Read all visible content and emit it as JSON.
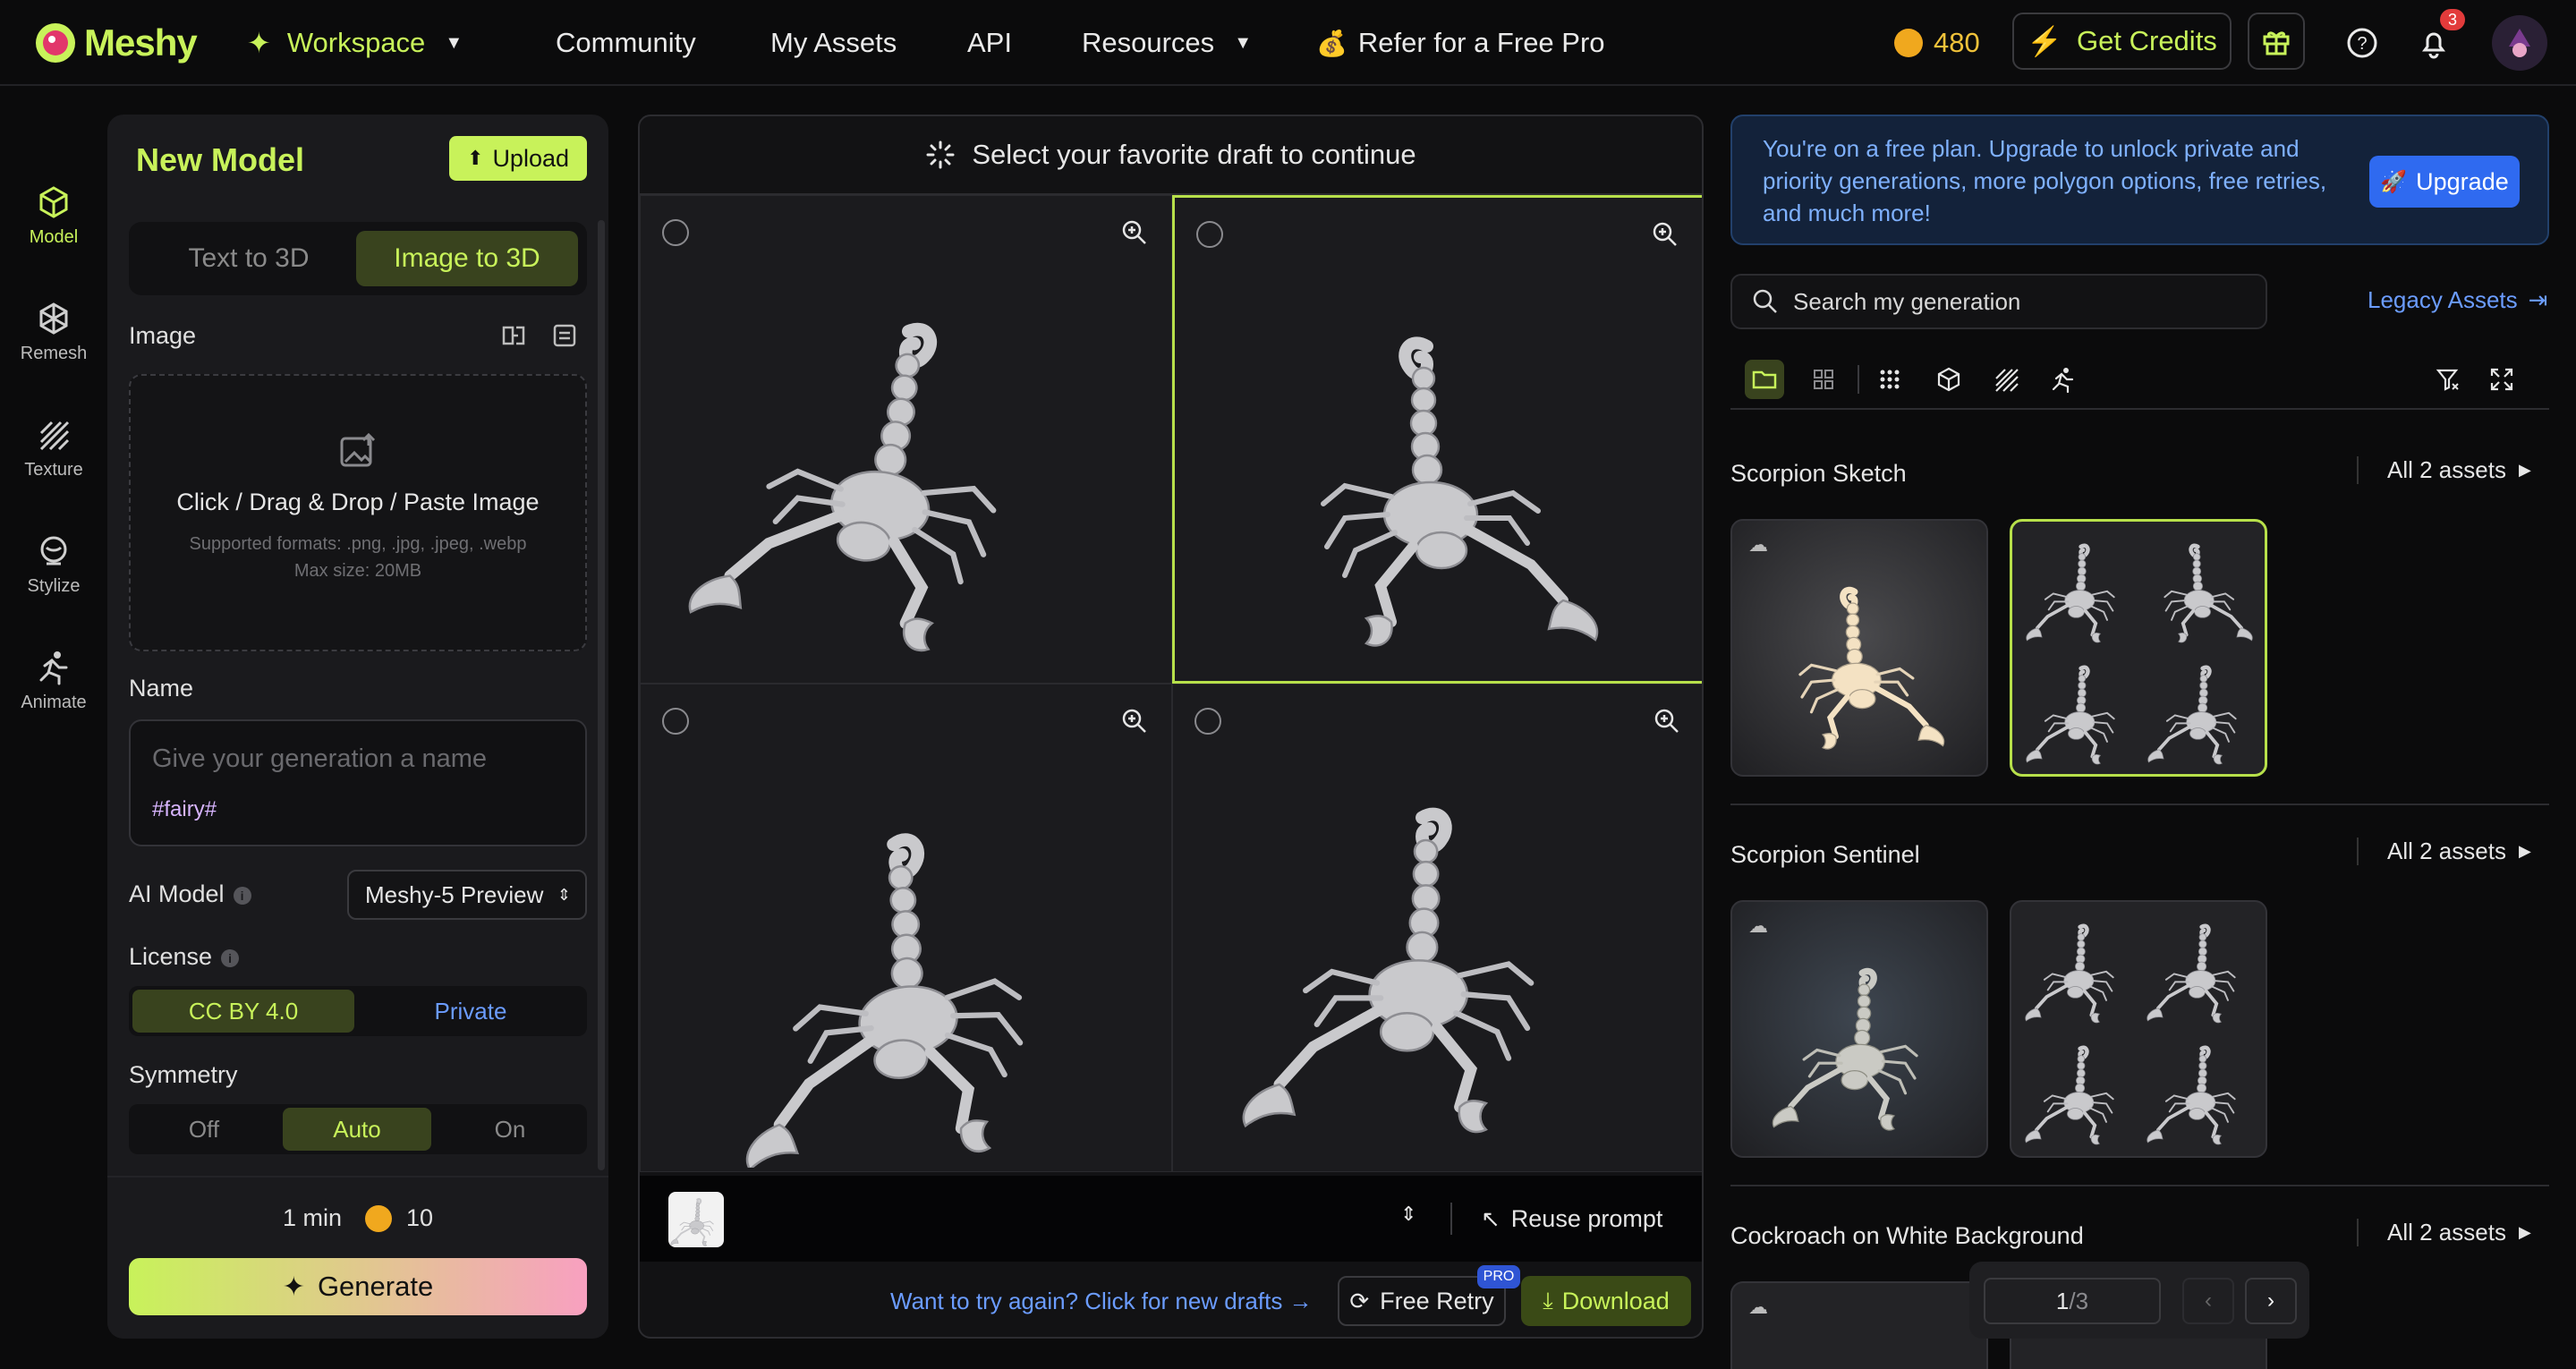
{
  "topbar": {
    "logo": "Meshy",
    "workspace": "Workspace",
    "nav": [
      "Community",
      "My Assets",
      "API",
      "Resources"
    ],
    "refer": "Refer for a Free Pro",
    "credits": "480",
    "get_credits": "Get Credits",
    "notif_count": "3"
  },
  "rail": [
    "Model",
    "Remesh",
    "Texture",
    "Stylize",
    "Animate"
  ],
  "left": {
    "title": "New Model",
    "upload": "Upload",
    "tabs": [
      "Text to 3D",
      "Image to 3D"
    ],
    "image_label": "Image",
    "dz_main": "Click / Drag & Drop / Paste Image",
    "dz_formats": "Supported formats: .png, .jpg, .jpeg, .webp",
    "dz_size": "Max size: 20MB",
    "name_label": "Name",
    "name_placeholder": "Give your generation a name",
    "name_tag": "#fairy#",
    "ai_model_label": "AI Model",
    "ai_model_value": "Meshy-5 Preview",
    "license_label": "License",
    "license_opts": [
      "CC BY 4.0",
      "Private"
    ],
    "symmetry_label": "Symmetry",
    "symmetry_opts": [
      "Off",
      "Auto",
      "On"
    ],
    "time": "1 min",
    "cost": "10",
    "generate": "Generate"
  },
  "center": {
    "header": "Select your favorite draft to continue",
    "reuse": "Reuse prompt",
    "retry_link": "Want to try again? Click for new drafts →",
    "free_retry": "Free Retry",
    "pro": "PRO",
    "download": "Download"
  },
  "right": {
    "banner": "You're on a free plan. Upgrade to unlock private and priority generations, more polygon options, free retries, and much more!",
    "upgrade": "Upgrade",
    "search_placeholder": "Search my generation",
    "legacy": "Legacy Assets",
    "groups": [
      {
        "title": "Scorpion Sketch",
        "all": "All 2 assets"
      },
      {
        "title": "Scorpion Sentinel",
        "all": "All 2 assets"
      },
      {
        "title": "Cockroach on White Background",
        "all": "All 2 assets"
      }
    ],
    "page_current": "1",
    "page_total": "/3"
  },
  "colors": {
    "accent": "#c8f25a",
    "link": "#6b9cff",
    "upgrade": "#2f6af0"
  }
}
